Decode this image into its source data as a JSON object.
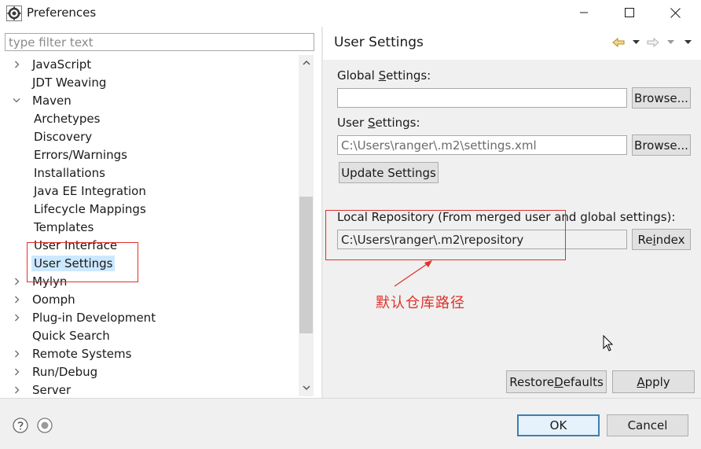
{
  "window": {
    "title": "Preferences"
  },
  "filter": {
    "placeholder": "type filter text"
  },
  "tree": {
    "items": [
      {
        "label": "JavaScript",
        "expander": "right"
      },
      {
        "label": "JDT Weaving",
        "expander": "none"
      },
      {
        "label": "Maven",
        "expander": "down"
      },
      {
        "label": "Archetypes",
        "expander": "child"
      },
      {
        "label": "Discovery",
        "expander": "child"
      },
      {
        "label": "Errors/Warnings",
        "expander": "child"
      },
      {
        "label": "Installations",
        "expander": "child"
      },
      {
        "label": "Java EE Integration",
        "expander": "child"
      },
      {
        "label": "Lifecycle Mappings",
        "expander": "child"
      },
      {
        "label": "Templates",
        "expander": "child"
      },
      {
        "label": "User Interface",
        "expander": "child"
      },
      {
        "label": "User Settings",
        "expander": "child",
        "selected": true
      },
      {
        "label": "Mylyn",
        "expander": "right"
      },
      {
        "label": "Oomph",
        "expander": "right"
      },
      {
        "label": "Plug-in Development",
        "expander": "right"
      },
      {
        "label": "Quick Search",
        "expander": "none"
      },
      {
        "label": "Remote Systems",
        "expander": "right"
      },
      {
        "label": "Run/Debug",
        "expander": "right"
      },
      {
        "label": "Server",
        "expander": "right"
      }
    ]
  },
  "page": {
    "title": "User Settings",
    "global_label": {
      "pre": "Global ",
      "mn": "S",
      "post": "ettings:"
    },
    "global_value": "",
    "browse_label": "Browse...",
    "user_label": {
      "pre": "User ",
      "mn": "S",
      "post": "ettings:"
    },
    "user_value": "C:\\Users\\ranger\\.m2\\settings.xml",
    "update_label": "Update Settings",
    "local_repo_label": "Local Repository (From merged user and global settings):",
    "local_repo_value": "C:\\Users\\ranger\\.m2\\repository",
    "reindex": {
      "pre": "Re",
      "mn": "i",
      "post": "ndex"
    },
    "restore": {
      "pre": "Restore ",
      "mn": "D",
      "post": "efaults"
    },
    "apply": {
      "pre": "",
      "mn": "A",
      "post": "pply"
    }
  },
  "annotation": {
    "text": "默认仓库路径",
    "color": "#e0302a"
  },
  "footer": {
    "ok_label": "OK",
    "cancel_label": "Cancel"
  },
  "icons": {
    "app": "eclipse-preferences-icon",
    "minimize": "minimize-icon",
    "maximize": "maximize-icon",
    "close": "close-icon",
    "back": "back-arrow-icon",
    "forward": "forward-arrow-icon",
    "menu": "view-menu-icon",
    "help": "help-icon",
    "import_export": "import-export-icon"
  }
}
